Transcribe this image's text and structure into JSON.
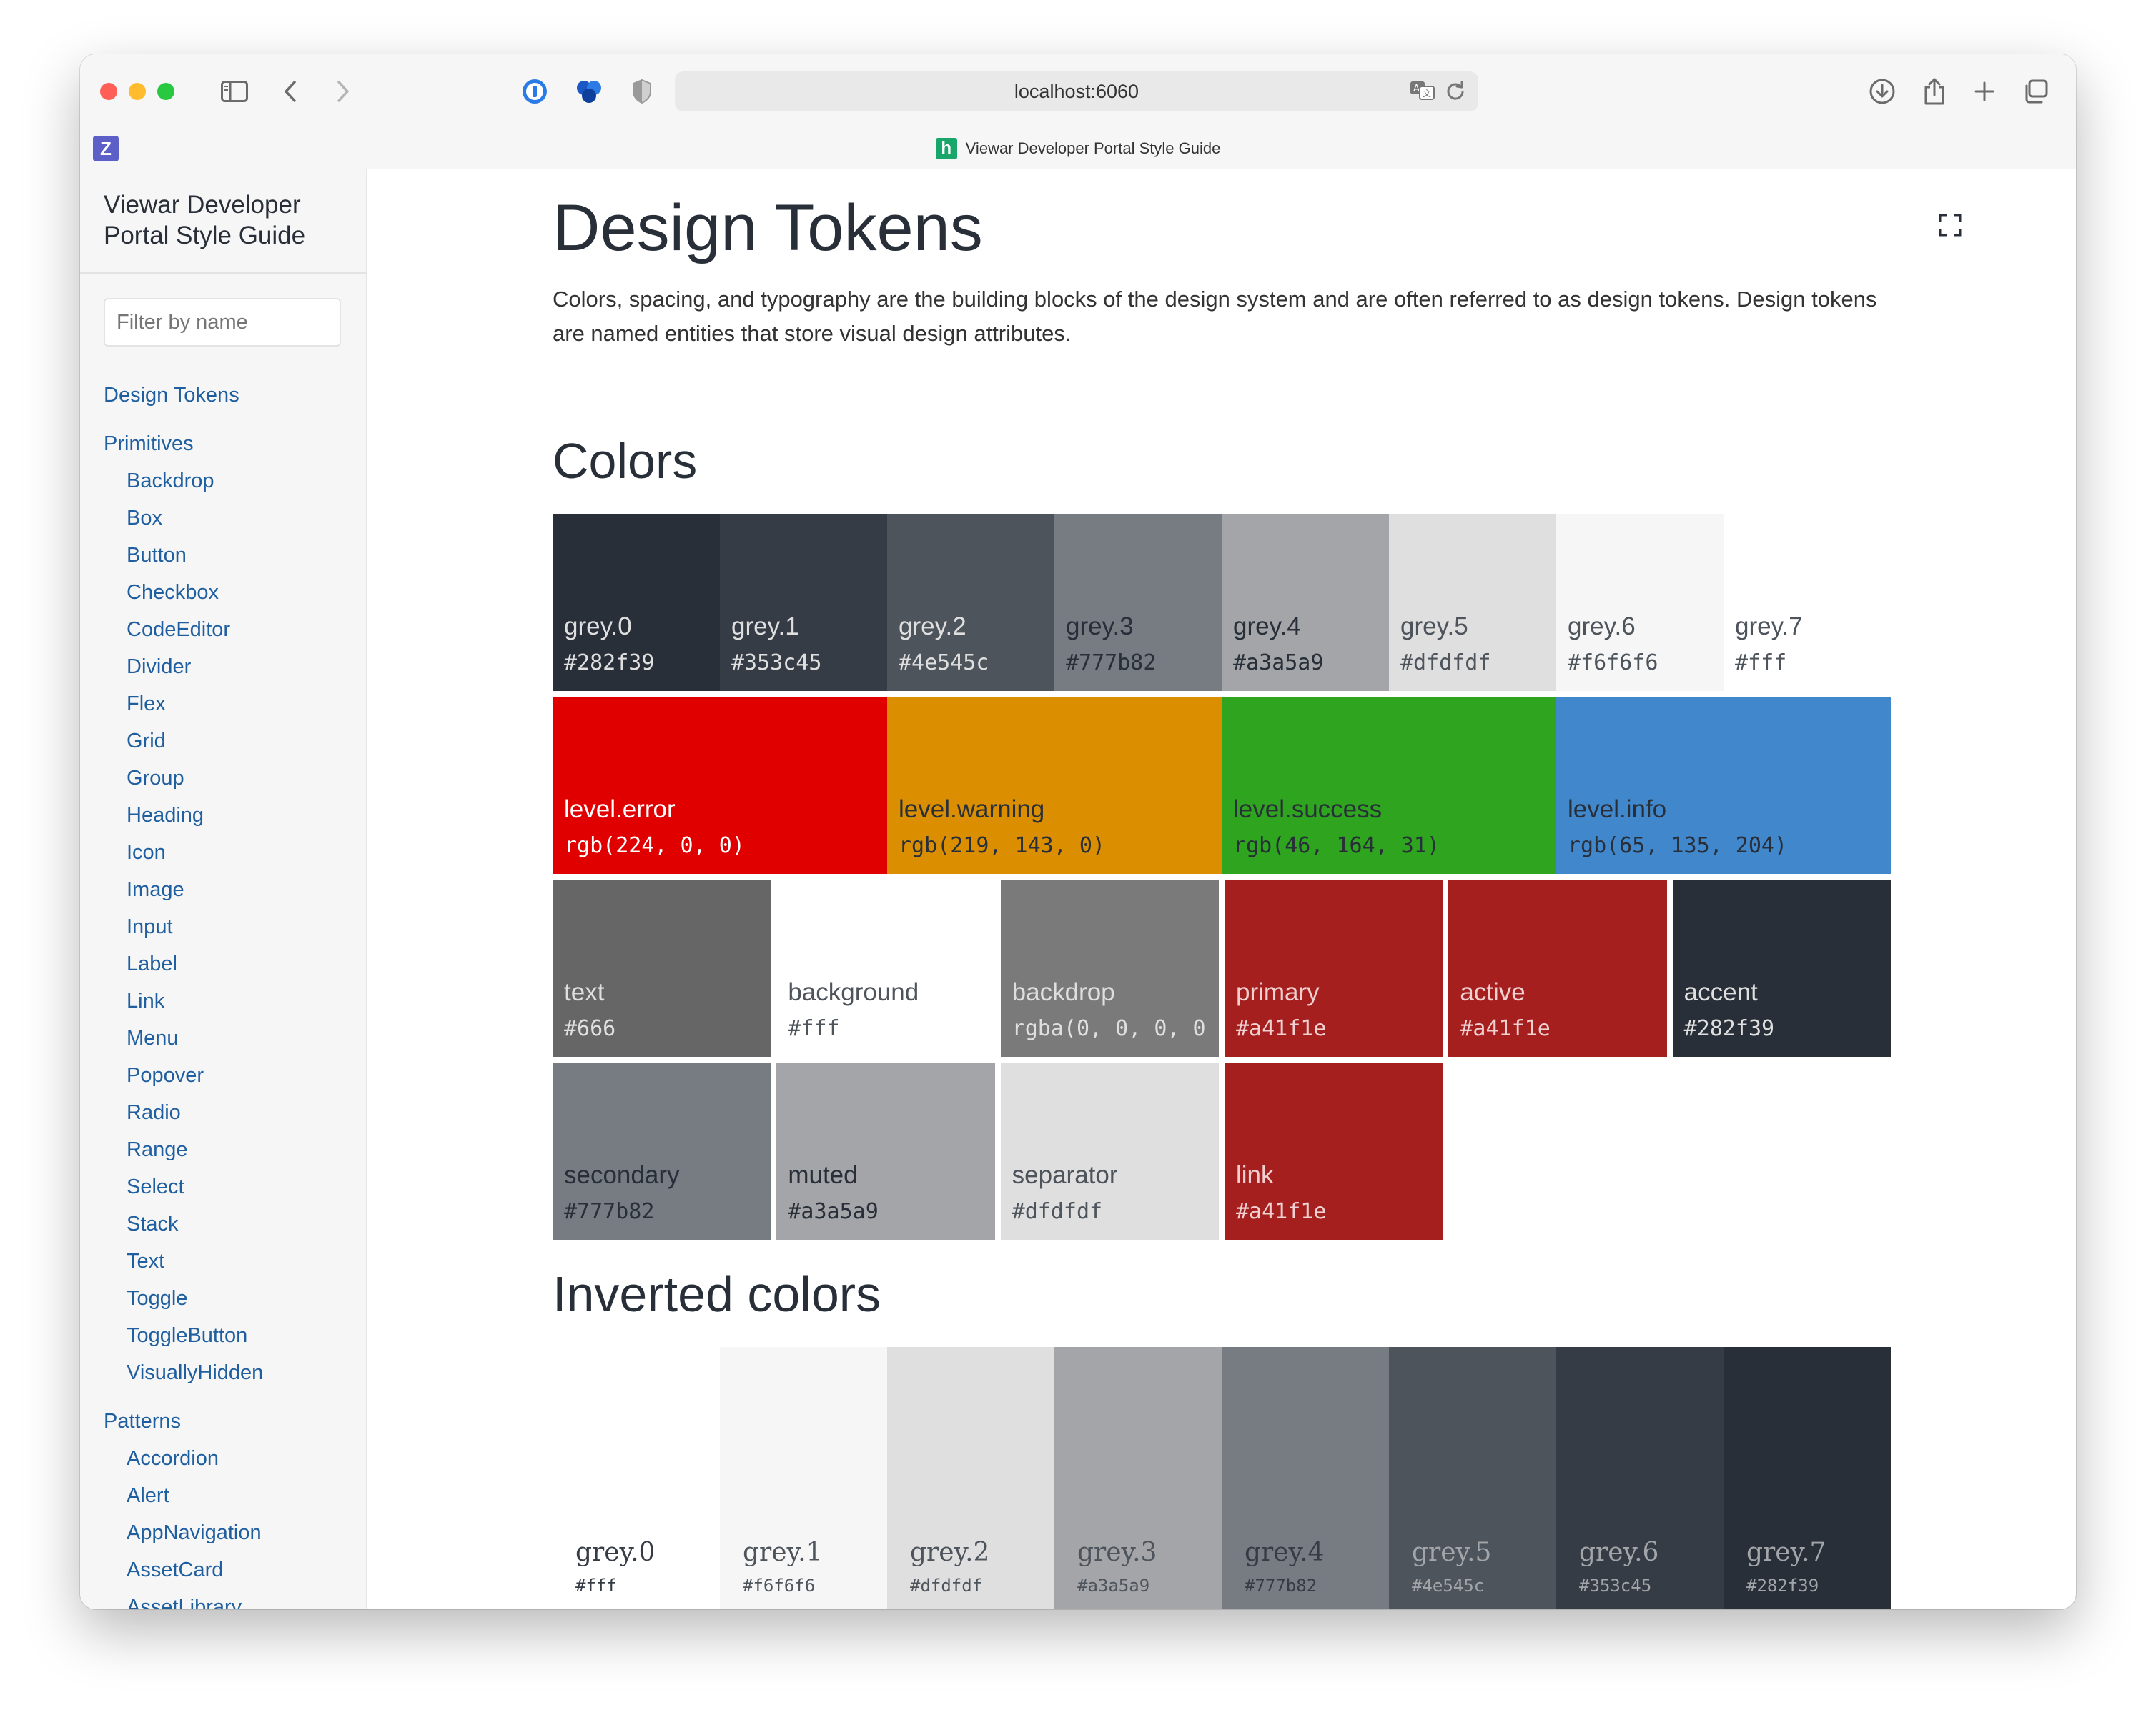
{
  "browser": {
    "url": "localhost:6060",
    "tab_title": "Viewar Developer Portal Style Guide",
    "extension_label": "Z",
    "favicon_label": "h"
  },
  "sidebar": {
    "title": "Viewar Developer Portal Style Guide",
    "filter_placeholder": "Filter by name",
    "sections": [
      {
        "label": "Design Tokens",
        "items": []
      },
      {
        "label": "Primitives",
        "items": [
          "Backdrop",
          "Box",
          "Button",
          "Checkbox",
          "CodeEditor",
          "Divider",
          "Flex",
          "Grid",
          "Group",
          "Heading",
          "Icon",
          "Image",
          "Input",
          "Label",
          "Link",
          "Menu",
          "Popover",
          "Radio",
          "Range",
          "Select",
          "Stack",
          "Text",
          "Toggle",
          "ToggleButton",
          "VisuallyHidden"
        ]
      },
      {
        "label": "Patterns",
        "items": [
          "Accordion",
          "Alert",
          "AppNavigation",
          "AssetCard",
          "AssetLibrary"
        ]
      }
    ]
  },
  "main": {
    "title": "Design Tokens",
    "intro": "Colors, spacing, and typography are the building blocks of the design system and are often referred to as design tokens. Design tokens are named entities that store visual design attributes.",
    "colors_heading": "Colors",
    "inverted_heading": "Inverted colors",
    "grey_swatches": [
      {
        "name": "grey.0",
        "value": "#282f39",
        "bg": "#282f39",
        "fg": "#dfdfdf"
      },
      {
        "name": "grey.1",
        "value": "#353c45",
        "bg": "#353c45",
        "fg": "#dfdfdf"
      },
      {
        "name": "grey.2",
        "value": "#4e545c",
        "bg": "#4e545c",
        "fg": "#dfdfdf"
      },
      {
        "name": "grey.3",
        "value": "#777b82",
        "bg": "#777b82",
        "fg": "#282f39"
      },
      {
        "name": "grey.4",
        "value": "#a3a5a9",
        "bg": "#a3a5a9",
        "fg": "#282f39"
      },
      {
        "name": "grey.5",
        "value": "#dfdfdf",
        "bg": "#dfdfdf",
        "fg": "#4e545c"
      },
      {
        "name": "grey.6",
        "value": "#f6f6f6",
        "bg": "#f6f6f6",
        "fg": "#4e545c"
      },
      {
        "name": "grey.7",
        "value": "#fff",
        "bg": "#ffffff",
        "fg": "#4e545c"
      }
    ],
    "level_swatches": [
      {
        "name": "level.error",
        "value": "rgb(224, 0, 0)",
        "bg": "#e00000",
        "fg": "#ffffff"
      },
      {
        "name": "level.warning",
        "value": "rgb(219, 143, 0)",
        "bg": "#db8f00",
        "fg": "#282f39"
      },
      {
        "name": "level.success",
        "value": "rgb(46, 164, 31)",
        "bg": "#2ea41f",
        "fg": "#282f39"
      },
      {
        "name": "level.info",
        "value": "rgb(65, 135, 204)",
        "bg": "#4187cc",
        "fg": "#282f39"
      }
    ],
    "semantic_row1": [
      {
        "name": "text",
        "value": "#666",
        "bg": "#666666",
        "fg": "#dfdfdf"
      },
      {
        "name": "background",
        "value": "#fff",
        "bg": "#ffffff",
        "fg": "#4e545c"
      },
      {
        "name": "backdrop",
        "value": "rgba(0, 0, 0, 0",
        "bg": "#7a7a7a",
        "fg": "#dfdfdf"
      },
      {
        "name": "primary",
        "value": "#a41f1e",
        "bg": "#a41f1e",
        "fg": "#f0d0d0"
      },
      {
        "name": "active",
        "value": "#a41f1e",
        "bg": "#a41f1e",
        "fg": "#f0d0d0"
      },
      {
        "name": "accent",
        "value": "#282f39",
        "bg": "#282f39",
        "fg": "#dfdfdf"
      }
    ],
    "semantic_row2": [
      {
        "name": "secondary",
        "value": "#777b82",
        "bg": "#777b82",
        "fg": "#282f39"
      },
      {
        "name": "muted",
        "value": "#a3a5a9",
        "bg": "#a3a5a9",
        "fg": "#282f39"
      },
      {
        "name": "separator",
        "value": "#dfdfdf",
        "bg": "#dfdfdf",
        "fg": "#4e545c"
      },
      {
        "name": "link",
        "value": "#a41f1e",
        "bg": "#a41f1e",
        "fg": "#f0d0d0"
      }
    ],
    "inverted_swatches": [
      {
        "name": "grey.0",
        "value": "#fff",
        "bg": "#ffffff",
        "fg": "#353c45"
      },
      {
        "name": "grey.1",
        "value": "#f6f6f6",
        "bg": "#f6f6f6",
        "fg": "#4e545c"
      },
      {
        "name": "grey.2",
        "value": "#dfdfdf",
        "bg": "#dfdfdf",
        "fg": "#4e545c"
      },
      {
        "name": "grey.3",
        "value": "#a3a5a9",
        "bg": "#a3a5a9",
        "fg": "#4e545c"
      },
      {
        "name": "grey.4",
        "value": "#777b82",
        "bg": "#777b82",
        "fg": "#353c45"
      },
      {
        "name": "grey.5",
        "value": "#4e545c",
        "bg": "#4e545c",
        "fg": "#a3a5a9"
      },
      {
        "name": "grey.6",
        "value": "#353c45",
        "bg": "#353c45",
        "fg": "#a3a5a9"
      },
      {
        "name": "grey.7",
        "value": "#282f39",
        "bg": "#282f39",
        "fg": "#a3a5a9"
      }
    ],
    "inverted_level_colors": [
      "#e00000",
      "#db8f00",
      "#2ea41f",
      "#4187cc"
    ]
  },
  "colors": {
    "link": "#1f5fa0",
    "heading": "#282f39",
    "traffic_red": "#ff5f57",
    "traffic_yellow": "#febc2e",
    "traffic_green": "#28c840"
  },
  "icons": {
    "toolbar": [
      "sidebar-icon",
      "back-icon",
      "forward-icon",
      "password-icon",
      "extension-icon",
      "shield-icon",
      "translate-icon",
      "reload-icon",
      "download-icon",
      "share-icon",
      "new-tab-icon",
      "tabs-overview-icon"
    ],
    "main": [
      "fullscreen-icon"
    ]
  }
}
